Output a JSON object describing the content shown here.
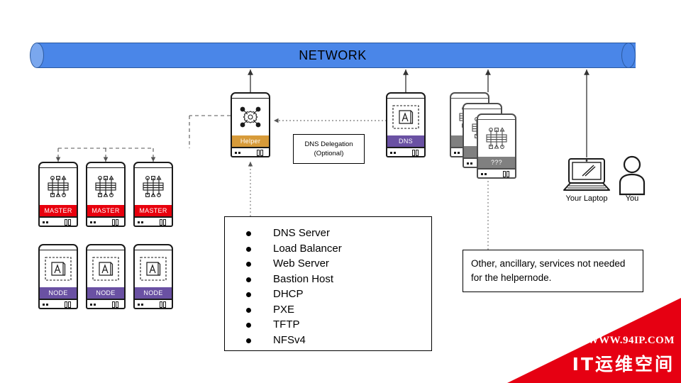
{
  "diagram": {
    "network": {
      "label": "NETWORK",
      "color": "#4a86e8"
    },
    "helper": {
      "band_label": "Helper",
      "band_color": "#d79b3a",
      "icon": "gear-network-icon"
    },
    "dns": {
      "band_label": "DNS",
      "band_color": "#6a51a3",
      "icon": "document-page-icon"
    },
    "unknown_stack": {
      "band_label": "???",
      "band_color": "#808080",
      "count": 3,
      "icon": "circuit-bus-icon"
    },
    "masters": [
      {
        "band_label": "MASTER",
        "band_color": "#e8000d",
        "icon": "circuit-bus-icon"
      },
      {
        "band_label": "MASTER",
        "band_color": "#e8000d",
        "icon": "circuit-bus-icon"
      },
      {
        "band_label": "MASTER",
        "band_color": "#e8000d",
        "icon": "circuit-bus-icon"
      }
    ],
    "nodes": [
      {
        "band_label": "NODE",
        "band_color": "#6a51a3",
        "icon": "document-page-icon"
      },
      {
        "band_label": "NODE",
        "band_color": "#6a51a3",
        "icon": "document-page-icon"
      },
      {
        "band_label": "NODE",
        "band_color": "#6a51a3",
        "icon": "document-page-icon"
      }
    ],
    "laptop": {
      "caption": "Your Laptop",
      "icon": "laptop-icon"
    },
    "person": {
      "caption": "You",
      "icon": "person-icon"
    },
    "dns_delegation_box": {
      "line1": "DNS Delegation",
      "line2": "(Optional)"
    },
    "ancillary_box": {
      "text": "Other, ancillary, services not needed for the helpernode."
    },
    "services_box": {
      "items": [
        "DNS Server",
        "Load Balancer",
        "Web Server",
        "Bastion Host",
        "DHCP",
        "PXE",
        "TFTP",
        "NFSv4"
      ]
    }
  },
  "watermark": {
    "url": "WWW.94IP.COM",
    "brand": "IT运维空间",
    "color": "#e60012"
  }
}
